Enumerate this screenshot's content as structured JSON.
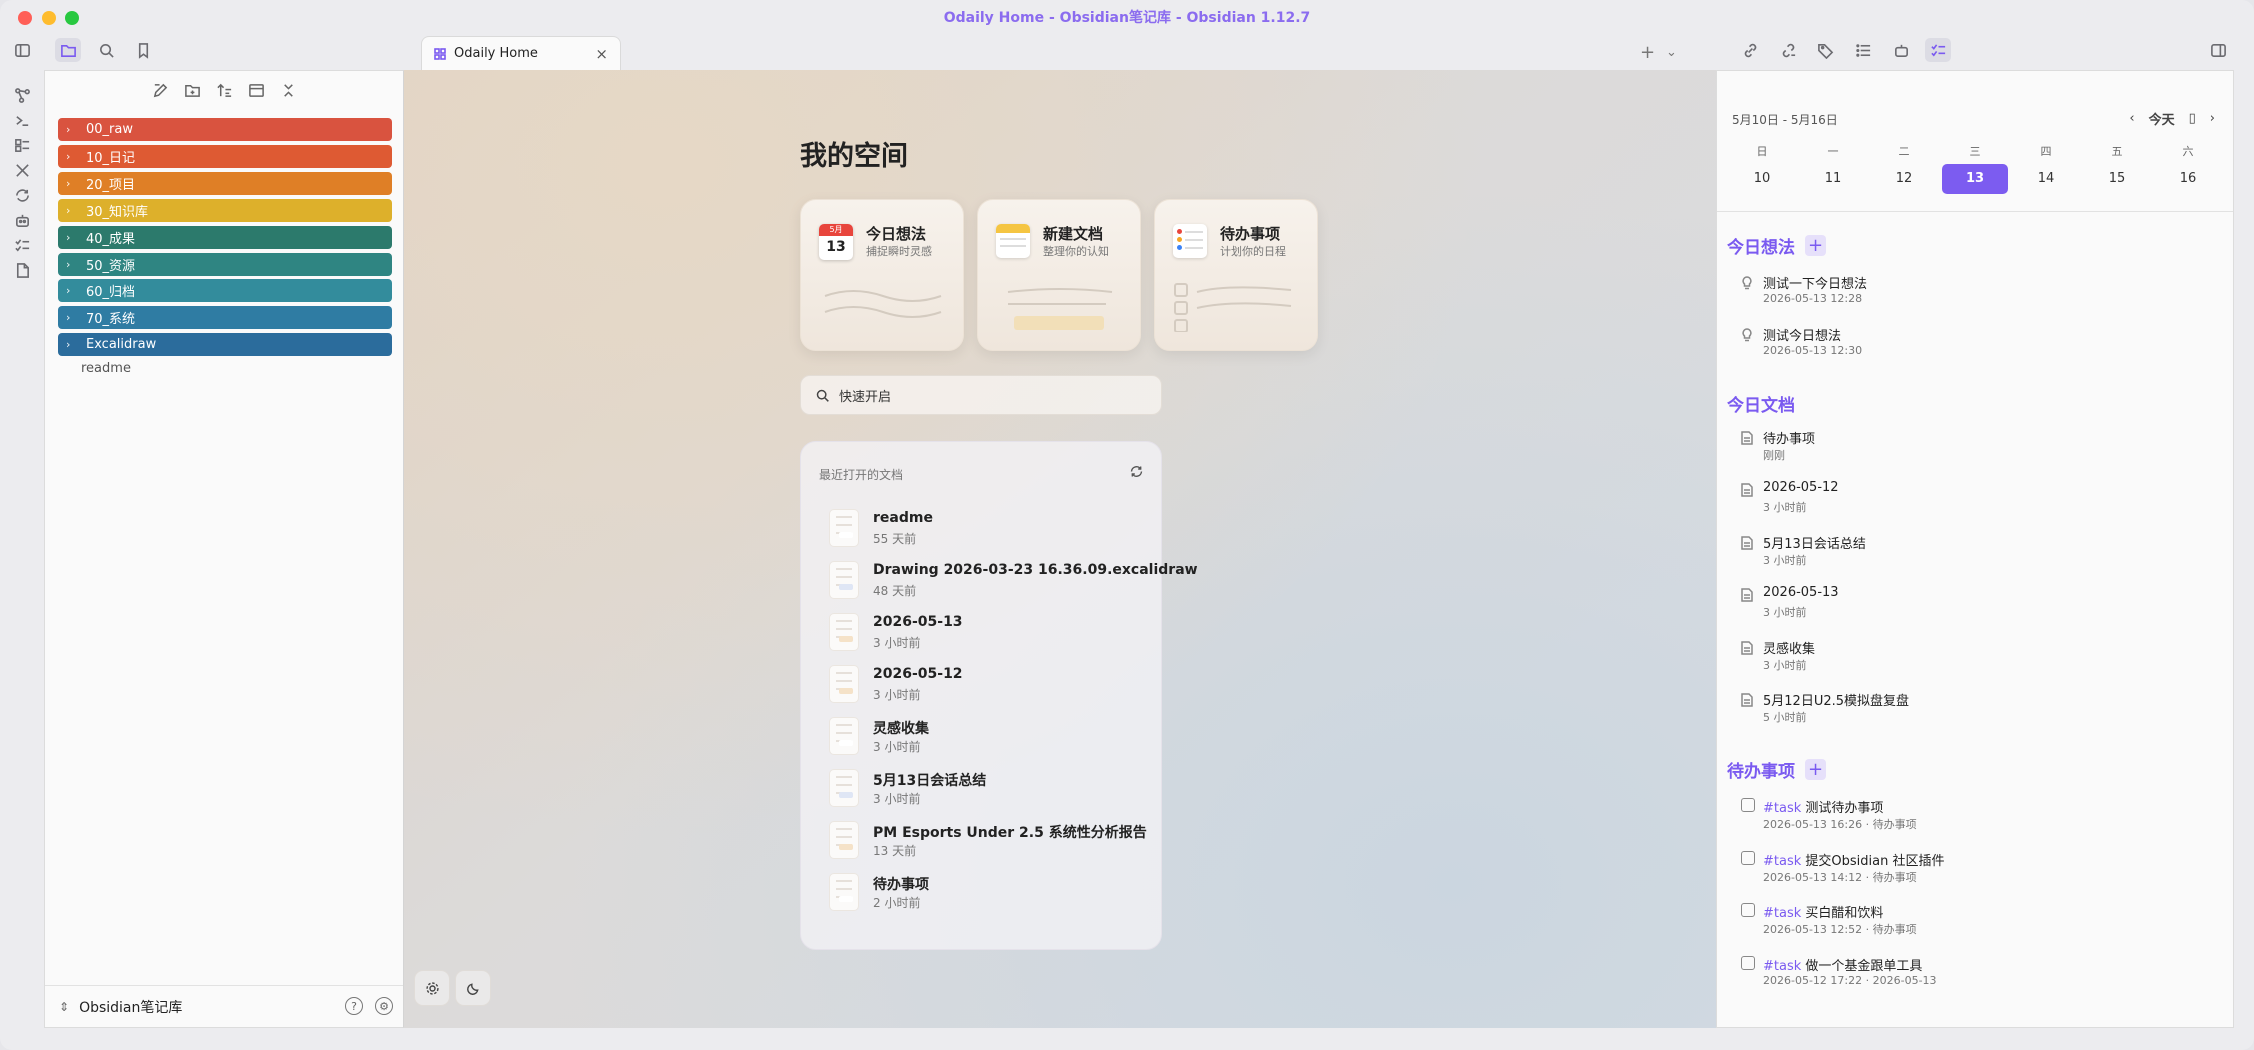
{
  "window": {
    "title": "Odaily Home - Obsidian笔记库 - Obsidian 1.12.7"
  },
  "tab": {
    "label": "Odaily Home"
  },
  "explorer": {
    "folders": [
      {
        "label": "00_raw",
        "color": "#d9533f"
      },
      {
        "label": "10_日记",
        "color": "#de5a33"
      },
      {
        "label": "20_项目",
        "color": "#df7f26"
      },
      {
        "label": "30_知识库",
        "color": "#ddb02b"
      },
      {
        "label": "40_成果",
        "color": "#2c7a6c"
      },
      {
        "label": "50_资源",
        "color": "#2f8582"
      },
      {
        "label": "60_归档",
        "color": "#338c9c"
      },
      {
        "label": "70_系统",
        "color": "#2f7ca3"
      },
      {
        "label": "Excalidraw",
        "color": "#2b6c9c"
      }
    ],
    "file": "readme",
    "vault_name": "Obsidian笔记库"
  },
  "home": {
    "title": "我的空间",
    "cards": [
      {
        "title": "今日想法",
        "subtitle": "捕捉瞬时灵感",
        "cal_month": "5月",
        "cal_day": "13"
      },
      {
        "title": "新建文档",
        "subtitle": "整理你的认知"
      },
      {
        "title": "待办事项",
        "subtitle": "计划你的日程"
      }
    ],
    "search_placeholder": "快速开启",
    "recent_header": "最近打开的文档",
    "recent": [
      {
        "name": "readme",
        "time": "55 天前",
        "accent": "#ffffff"
      },
      {
        "name": "Drawing 2026-03-23 16.36.09.excalidraw",
        "time": "48 天前",
        "accent": "#dfe6f5"
      },
      {
        "name": "2026-05-13",
        "time": "3 小时前",
        "accent": "#f5e2c8"
      },
      {
        "name": "2026-05-12",
        "time": "3 小时前",
        "accent": "#f5e2c8"
      },
      {
        "name": "灵感收集",
        "time": "3 小时前",
        "accent": "#ffffff"
      },
      {
        "name": "5月13日会话总结",
        "time": "3 小时前",
        "accent": "#dfe6f5"
      },
      {
        "name": "PM Esports Under 2.5 系统性分析报告",
        "time": "13 天前",
        "accent": "#f5e2c8"
      },
      {
        "name": "待办事项",
        "time": "2 小时前",
        "accent": "#ffffff"
      }
    ]
  },
  "calendar": {
    "range": "5月10日 - 5月16日",
    "today_label": "今天",
    "weekdays": [
      "日",
      "一",
      "二",
      "三",
      "四",
      "五",
      "六"
    ],
    "days": [
      "10",
      "11",
      "12",
      "13",
      "14",
      "15",
      "16"
    ],
    "selected_index": 3
  },
  "sidebar": {
    "ideas_title": "今日想法",
    "ideas": [
      {
        "title": "测试一下今日想法",
        "time": "2026-05-13 12:28"
      },
      {
        "title": "测试今日想法",
        "time": "2026-05-13 12:30"
      }
    ],
    "docs_title": "今日文档",
    "docs": [
      {
        "title": "待办事项",
        "time": "刚刚"
      },
      {
        "title": "2026-05-12",
        "time": "3 小时前"
      },
      {
        "title": "5月13日会话总结",
        "time": "3 小时前"
      },
      {
        "title": "2026-05-13",
        "time": "3 小时前"
      },
      {
        "title": "灵感收集",
        "time": "3 小时前"
      },
      {
        "title": "5月12日U2.5模拟盘复盘",
        "time": "5 小时前"
      }
    ],
    "tasks_title": "待办事项",
    "tasks": [
      {
        "tag": "#task",
        "title": "测试待办事项",
        "meta": "2026-05-13 16:26 · 待办事项"
      },
      {
        "tag": "#task",
        "title": "提交Obsidian 社区插件",
        "meta": "2026-05-13 14:12 · 待办事项"
      },
      {
        "tag": "#task",
        "title": "买白醋和饮料",
        "meta": "2026-05-13 12:52 · 待办事项"
      },
      {
        "tag": "#task",
        "title": "做一个基金跟单工具",
        "meta": "2026-05-12 17:22 · 2026-05-13"
      }
    ]
  },
  "colors": {
    "accent": "#7a5af0"
  }
}
